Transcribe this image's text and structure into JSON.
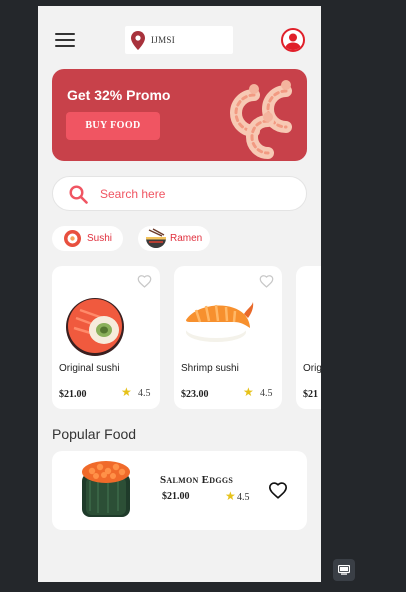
{
  "header": {
    "location_text": "IJMSI"
  },
  "promo": {
    "title": "Get 32% Promo",
    "button_label": "BUY FOOD"
  },
  "search": {
    "placeholder": "Search here"
  },
  "categories": [
    {
      "label": "Sushi"
    },
    {
      "label": "Ramen"
    }
  ],
  "food_cards": [
    {
      "name": "Original sushi",
      "price": "$21.00",
      "rating": "4.5"
    },
    {
      "name": "Shrimp  sushi",
      "price": "$23.00",
      "rating": "4.5"
    },
    {
      "name": "Orig",
      "price": "$21"
    }
  ],
  "popular": {
    "title": "Popular Food",
    "item": {
      "name": "Salmon Edggs",
      "price": "$21.00",
      "rating": "4.5"
    }
  },
  "colors": {
    "accent": "#f05562",
    "promo_bg": "#c8414a",
    "star": "#e6c21a"
  }
}
